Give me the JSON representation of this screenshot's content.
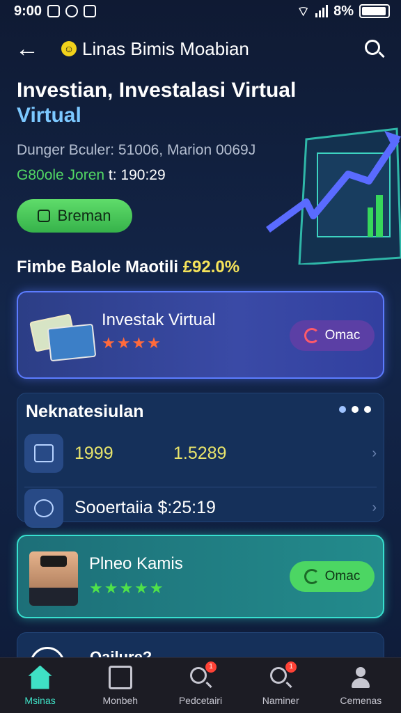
{
  "status_bar": {
    "time": "9:00",
    "battery": "8%"
  },
  "header": {
    "title": "Linas Bimis Moabian"
  },
  "hero": {
    "title": "Investian, Investalasi Virtual",
    "subtitle": "Virtual",
    "meta_line1": "Dunger Bculer: 51006, Marion 0069J",
    "meta_line2_highlight": "G80ole Joren",
    "meta_line2_rest": " t: 190:29",
    "primary_button": "Breman"
  },
  "balance": {
    "label": "Fimbe Balole Maotili ",
    "value": "£92.0%"
  },
  "invest_card": {
    "title": "Investak Virtual",
    "stars": "★★★★",
    "button": "Omac"
  },
  "list_card": {
    "header": "Neknatesiulan",
    "row1": {
      "val_a": "1999",
      "val_b": "1.5289"
    },
    "row2": {
      "text": "Sooertaiia $:25:19"
    }
  },
  "person_card": {
    "name": "Plneo Kamis",
    "stars": "★★★★★",
    "button": "Omac"
  },
  "peek_card": {
    "text": "Qailure?"
  },
  "nav": {
    "items": [
      {
        "label": "Msinas",
        "active": true
      },
      {
        "label": "Monbeh",
        "active": false
      },
      {
        "label": "Pedcetairi",
        "active": false,
        "badge": "1"
      },
      {
        "label": "Naminer",
        "active": false,
        "badge": "1"
      },
      {
        "label": "Cemenas",
        "active": false
      }
    ]
  }
}
